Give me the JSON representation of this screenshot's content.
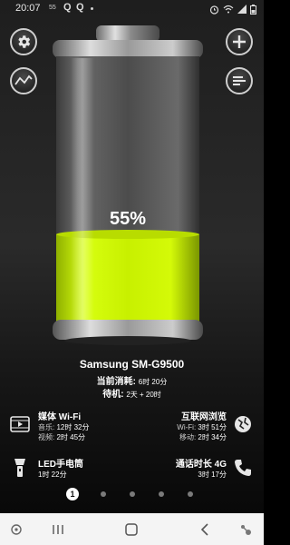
{
  "status_bar": {
    "time": "20:07",
    "battery_small": "55",
    "icons": [
      "q-icon",
      "q-icon",
      "alarm-icon",
      "wifi-icon",
      "signal-icon",
      "battery-icon"
    ]
  },
  "battery": {
    "level_percent": 55,
    "level_label": "55%",
    "fill_color": "#c8f000"
  },
  "device": {
    "name": "Samsung SM-G9500",
    "usage_label": "当前消耗:",
    "usage_value": "6时 20分",
    "standby_label": "待机:",
    "standby_value": "2天 + 20时"
  },
  "features": {
    "media_wifi": {
      "title": "媒体 Wi-Fi",
      "line1_label": "音乐:",
      "line1_value": "12时 32分",
      "line2_label": "视频:",
      "line2_value": "2时 45分"
    },
    "internet": {
      "title": "互联网浏览",
      "line1_label": "Wi-Fi:",
      "line1_value": "3时 51分",
      "line2_label": "移动:",
      "line2_value": "2时 34分"
    },
    "flashlight": {
      "title": "LED手电筒",
      "line1_value": "1时 22分"
    },
    "call": {
      "title": "通话时长 4G",
      "line1_value": "3时 17分"
    }
  },
  "pager": {
    "active_label": "1",
    "count": 5,
    "active_index": 0
  },
  "colors": {
    "accent": "#c8f000",
    "navbar_bg": "#f4f4f4"
  }
}
